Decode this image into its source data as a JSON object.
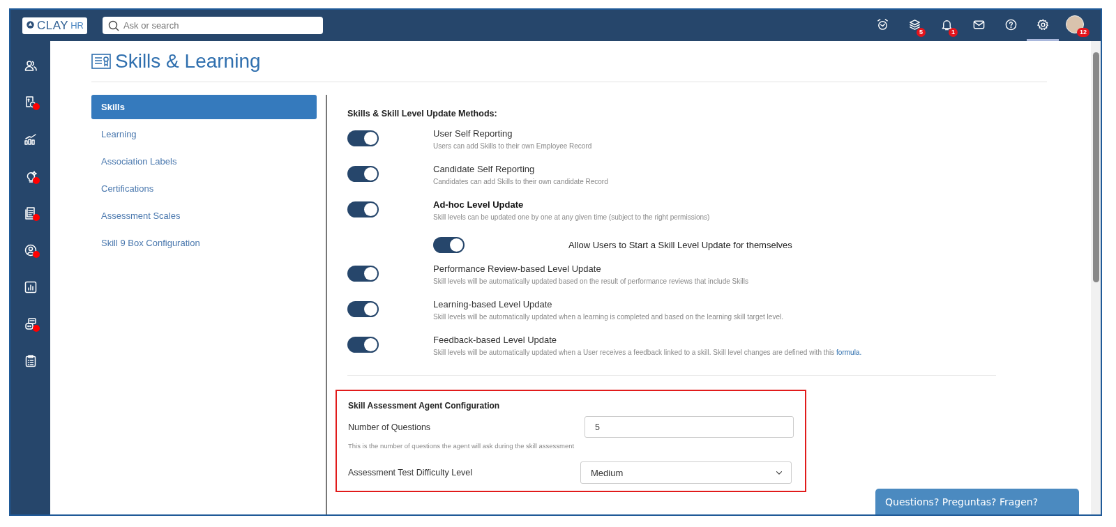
{
  "header": {
    "logo": {
      "name": "CLAY",
      "suffix": "HR"
    },
    "search": {
      "placeholder": "Ask or search"
    },
    "icons": [
      {
        "kind": "alarm",
        "selected": false
      },
      {
        "kind": "stack",
        "badge": "5",
        "selected": false
      },
      {
        "kind": "bell",
        "badge": "1",
        "selected": false
      },
      {
        "kind": "mail",
        "selected": false
      },
      {
        "kind": "help",
        "selected": false
      },
      {
        "kind": "gear",
        "selected": true
      },
      {
        "kind": "avatar",
        "badge": "12",
        "selected": false
      }
    ]
  },
  "sidebar": {
    "items": [
      {
        "kind": "people",
        "dot": false
      },
      {
        "kind": "payroll",
        "dot": true
      },
      {
        "kind": "growth",
        "dot": false
      },
      {
        "kind": "idea",
        "dot": true
      },
      {
        "kind": "docs",
        "dot": true
      },
      {
        "kind": "person",
        "dot": true
      },
      {
        "kind": "report",
        "dot": false
      },
      {
        "kind": "bot",
        "dot": true
      },
      {
        "kind": "clipboard",
        "dot": false
      }
    ]
  },
  "page": {
    "title": "Skills & Learning"
  },
  "nav": {
    "items": [
      {
        "label": "Skills",
        "selected": true
      },
      {
        "label": "Learning",
        "selected": false
      },
      {
        "label": "Association Labels",
        "selected": false
      },
      {
        "label": "Certifications",
        "selected": false
      },
      {
        "label": "Assessment Scales",
        "selected": false
      },
      {
        "label": "Skill 9 Box Configuration",
        "selected": false
      }
    ]
  },
  "methods": {
    "heading": "Skills & Skill Level Update Methods:",
    "settings": [
      {
        "title": "User Self Reporting",
        "description": "Users can add Skills to their own Employee Record",
        "on": true,
        "emphasized": false
      },
      {
        "title": "Candidate Self Reporting",
        "description": "Candidates can add Skills to their own candidate Record",
        "on": true,
        "emphasized": false
      },
      {
        "title": "Ad-hoc Level Update",
        "description": "Skill levels can be updated one by one at any given time (subject to the right permissions)",
        "on": true,
        "emphasized": true,
        "children": [
          {
            "title": "Allow Users to Start a Skill Level Update for themselves",
            "on": true
          }
        ]
      },
      {
        "title": "Performance Review-based Level Update",
        "description": "Skill levels will be automatically updated based on the result of performance reviews that include Skills",
        "on": true,
        "emphasized": false
      },
      {
        "title": "Learning-based Level Update",
        "description": "Skill levels will be automatically updated when a learning is completed and based on the learning skill target level.",
        "on": true,
        "emphasized": false
      },
      {
        "title": "Feedback-based Level Update",
        "description": "Skill levels will be automatically updated when a User receives a feedback linked to a skill. Skill level changes are defined with this",
        "link": "formula.",
        "on": true,
        "emphasized": false
      }
    ]
  },
  "agent_config": {
    "title": "Skill Assessment Agent Configuration",
    "highlighted": true,
    "fields": [
      {
        "kind": "input",
        "label": "Number of Questions",
        "value": "5",
        "hint": "This is the number of questions the agent will ask during the skill assessment"
      },
      {
        "kind": "select",
        "label": "Assessment Test Difficulty Level",
        "value": "Medium"
      }
    ]
  },
  "chat_button": {
    "label": "Questions? Preguntas? Fragen?"
  }
}
